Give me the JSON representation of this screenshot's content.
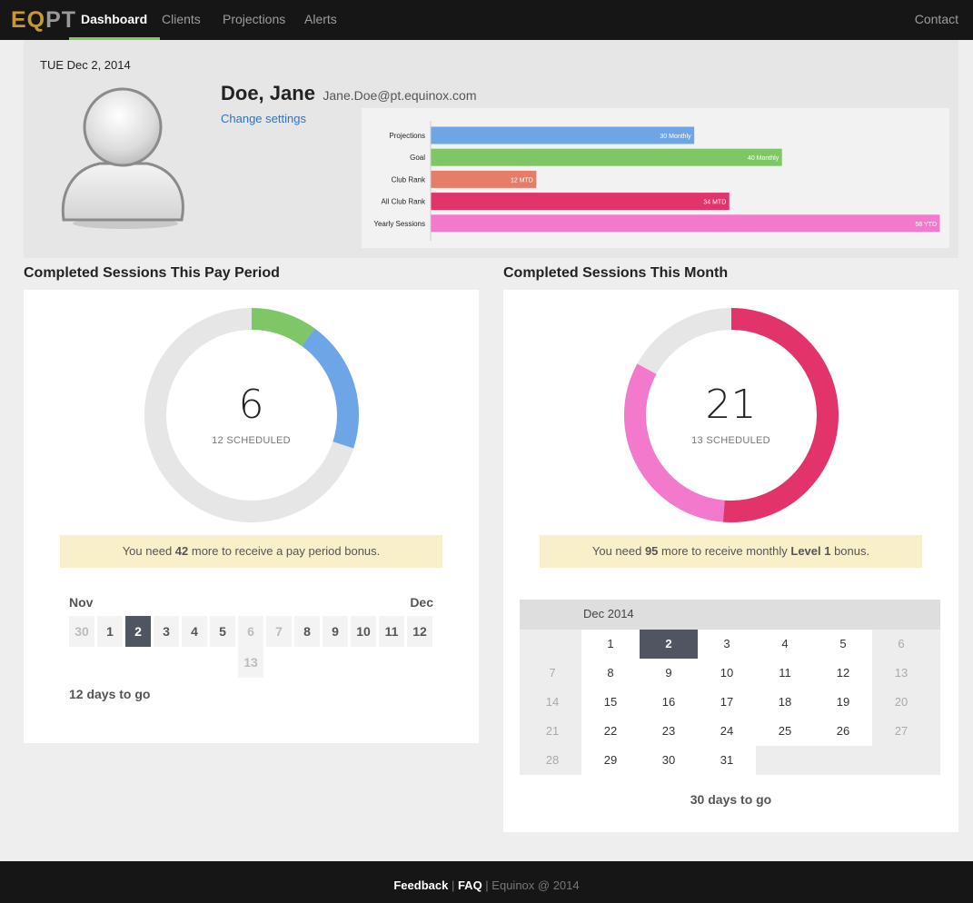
{
  "nav": {
    "logo_eq": "EQ",
    "logo_pt": "PT",
    "items": [
      "Dashboard",
      "Clients",
      "Projections",
      "Alerts"
    ],
    "contact": "Contact",
    "active": "Dashboard"
  },
  "profile": {
    "date": "TUE Dec 2, 2014",
    "name": "Doe, Jane",
    "email": "Jane.Doe@pt.equinox.com",
    "change_settings": "Change settings"
  },
  "stats_chart": {
    "type": "bar",
    "orientation": "horizontal",
    "categories": [
      "Projections",
      "Goal",
      "Club Rank",
      "All Club Rank",
      "Yearly Sessions"
    ],
    "values": [
      30,
      40,
      12,
      34,
      58
    ],
    "labels": [
      "30 Monthly",
      "40 Monthly",
      "12 MTD",
      "34 MTD",
      "58 YTD"
    ],
    "colors": [
      "#6ea5e6",
      "#7fc766",
      "#e57d68",
      "#e3336b",
      "#f279cc"
    ],
    "xlim": [
      0,
      58
    ]
  },
  "pay_period": {
    "title": "Completed Sessions This Pay Period",
    "completed": "6",
    "scheduled_label": "12 SCHEDULED",
    "donut": {
      "green": 6,
      "blue": 12,
      "remaining": 42,
      "colors": {
        "green": "#7fc766",
        "blue": "#6ea5e6",
        "track": "#e6e6e6"
      }
    },
    "notice": {
      "pre": "You need ",
      "num": "42",
      "post": " more to receive a pay period bonus."
    },
    "month_start": "Nov",
    "month_end": "Dec",
    "days": [
      {
        "d": "30",
        "state": "muted"
      },
      {
        "d": "1",
        "state": ""
      },
      {
        "d": "2",
        "state": "today"
      },
      {
        "d": "3",
        "state": ""
      },
      {
        "d": "4",
        "state": ""
      },
      {
        "d": "5",
        "state": ""
      },
      {
        "d": "6",
        "state": "muted"
      },
      {
        "d": "7",
        "state": "muted"
      },
      {
        "d": "8",
        "state": ""
      },
      {
        "d": "9",
        "state": ""
      },
      {
        "d": "10",
        "state": ""
      },
      {
        "d": "11",
        "state": ""
      },
      {
        "d": "12",
        "state": ""
      },
      {
        "d": "13",
        "state": "muted"
      }
    ],
    "days_left": "12 days to go"
  },
  "month": {
    "title": "Completed Sessions This Month",
    "completed": "21",
    "scheduled_label": "13 SCHEDULED",
    "donut": {
      "crimson": 21,
      "pink": 13,
      "remaining": 7,
      "colors": {
        "crimson": "#e3336b",
        "pink": "#f279cc",
        "track": "#e6e6e6"
      }
    },
    "notice": {
      "pre": "You need ",
      "num": "95",
      "mid": " more to receive monthly ",
      "level": "Level 1",
      "post": " bonus."
    },
    "calendar_title": "Dec 2014",
    "weeks": [
      [
        {
          "d": "",
          "s": "blank"
        },
        {
          "d": "1",
          "s": "white"
        },
        {
          "d": "2",
          "s": "today"
        },
        {
          "d": "3",
          "s": "white"
        },
        {
          "d": "4",
          "s": "white"
        },
        {
          "d": "5",
          "s": "white"
        },
        {
          "d": "6",
          "s": "muted"
        }
      ],
      [
        {
          "d": "7",
          "s": "muted"
        },
        {
          "d": "8",
          "s": "white"
        },
        {
          "d": "9",
          "s": "white"
        },
        {
          "d": "10",
          "s": "white"
        },
        {
          "d": "11",
          "s": "white"
        },
        {
          "d": "12",
          "s": "white"
        },
        {
          "d": "13",
          "s": "muted"
        }
      ],
      [
        {
          "d": "14",
          "s": "muted"
        },
        {
          "d": "15",
          "s": "white"
        },
        {
          "d": "16",
          "s": "white"
        },
        {
          "d": "17",
          "s": "white"
        },
        {
          "d": "18",
          "s": "white"
        },
        {
          "d": "19",
          "s": "white"
        },
        {
          "d": "20",
          "s": "muted"
        }
      ],
      [
        {
          "d": "21",
          "s": "muted"
        },
        {
          "d": "22",
          "s": "white"
        },
        {
          "d": "23",
          "s": "white"
        },
        {
          "d": "24",
          "s": "white"
        },
        {
          "d": "25",
          "s": "white"
        },
        {
          "d": "26",
          "s": "white"
        },
        {
          "d": "27",
          "s": "muted"
        }
      ],
      [
        {
          "d": "28",
          "s": "muted"
        },
        {
          "d": "29",
          "s": "white"
        },
        {
          "d": "30",
          "s": "white"
        },
        {
          "d": "31",
          "s": "white"
        },
        {
          "d": "",
          "s": "blank"
        },
        {
          "d": "",
          "s": "blank"
        },
        {
          "d": "",
          "s": "blank"
        }
      ]
    ],
    "days_left": "30 days to go"
  },
  "footer": {
    "feedback": "Feedback",
    "sep1": " | ",
    "faq": "FAQ",
    "sep2": " | ",
    "copyright": "Equinox @ 2014"
  }
}
